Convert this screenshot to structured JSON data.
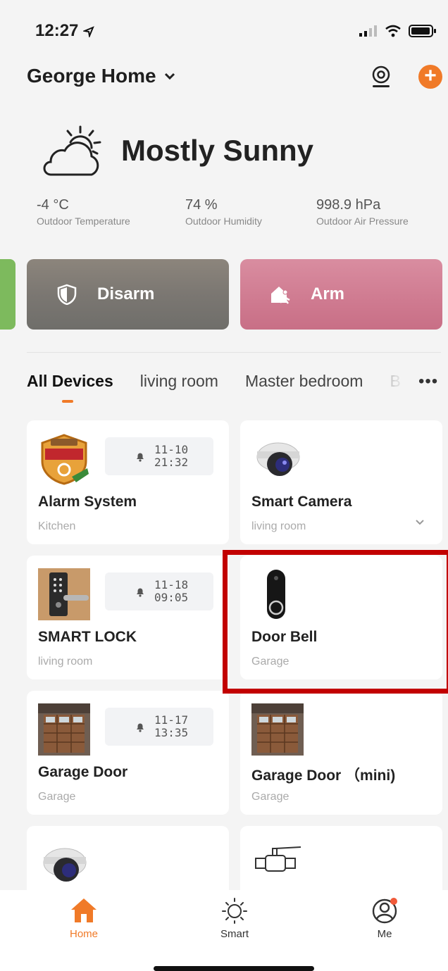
{
  "status_bar": {
    "time": "12:27"
  },
  "header": {
    "home_name": "George Home"
  },
  "weather": {
    "condition": "Mostly Sunny",
    "metrics": [
      {
        "value": "-4 °C",
        "label": "Outdoor Temperature"
      },
      {
        "value": "74 %",
        "label": "Outdoor Humidity"
      },
      {
        "value": "998.9 hPa",
        "label": "Outdoor Air Pressure"
      }
    ]
  },
  "scenes": [
    {
      "label": "Disarm",
      "icon": "shield-icon"
    },
    {
      "label": "Arm",
      "icon": "house-walk-icon"
    }
  ],
  "tabs": [
    {
      "label": "All Devices",
      "active": true
    },
    {
      "label": "living room"
    },
    {
      "label": "Master bedroom"
    },
    {
      "label": "B"
    }
  ],
  "more_label": "•••",
  "devices": [
    {
      "name": "Alarm System",
      "room": "Kitchen",
      "alert_date": "11-10",
      "alert_time": "21:32",
      "thumb": "alarm-badge"
    },
    {
      "name": "Smart Camera",
      "room": "living room",
      "thumb": "dome-camera"
    },
    {
      "name": "SMART LOCK",
      "room": "living room",
      "alert_date": "11-18",
      "alert_time": "09:05",
      "thumb": "smart-lock"
    },
    {
      "name": "Door Bell",
      "room": "Garage",
      "thumb": "doorbell"
    },
    {
      "name": "Garage Door",
      "room": "Garage",
      "alert_date": "11-17",
      "alert_time": "13:35",
      "thumb": "garage-door"
    },
    {
      "name": "Garage Door （mini)",
      "room": "Garage",
      "thumb": "garage-door"
    }
  ],
  "bottom_nav": [
    {
      "label": "Home",
      "active": true
    },
    {
      "label": "Smart"
    },
    {
      "label": "Me"
    }
  ],
  "colors": {
    "accent": "#f07a28",
    "highlight": "#c20000",
    "arm": "#cf7a90",
    "disarm": "#7b7772"
  }
}
